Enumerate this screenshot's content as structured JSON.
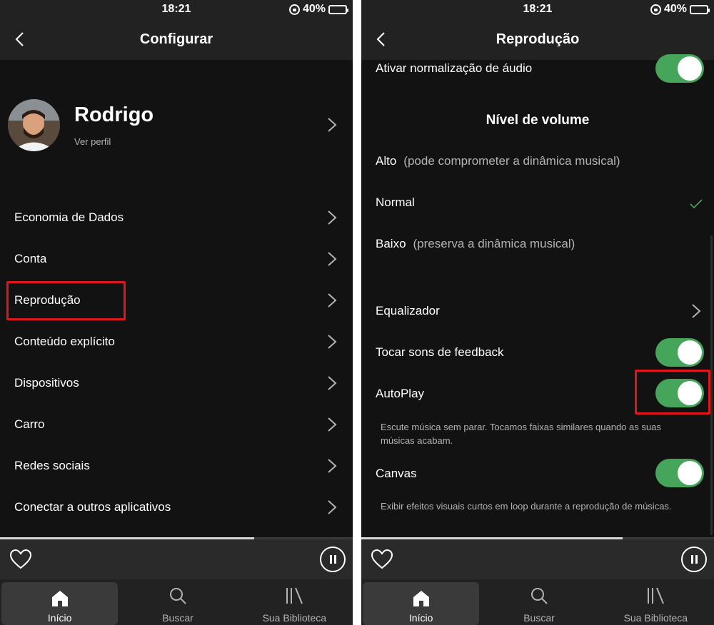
{
  "status": {
    "time": "18:21",
    "battery": "40%"
  },
  "left": {
    "title": "Configurar",
    "profile": {
      "name": "Rodrigo",
      "sub": "Ver perfil"
    },
    "menu": [
      {
        "label": "Economia de Dados"
      },
      {
        "label": "Conta"
      },
      {
        "label": "Reprodução"
      },
      {
        "label": "Conteúdo explícito"
      },
      {
        "label": "Dispositivos"
      },
      {
        "label": "Carro"
      },
      {
        "label": "Redes sociais"
      },
      {
        "label": "Conectar a outros aplicativos"
      }
    ]
  },
  "right": {
    "title": "Reprodução",
    "normalize": "Ativar normalização de áudio",
    "volume_title": "Nível de volume",
    "volume": [
      {
        "label": "Alto",
        "hint": "(pode comprometer a dinâmica musical)"
      },
      {
        "label": "Normal",
        "hint": "",
        "selected": true
      },
      {
        "label": "Baixo",
        "hint": "(preserva a dinâmica musical)"
      }
    ],
    "equalizer": "Equalizador",
    "feedback": "Tocar sons de feedback",
    "autoplay": "AutoPlay",
    "autoplay_desc": "Escute música sem parar. Tocamos faixas similares quando as suas músicas acabam.",
    "canvas": "Canvas",
    "canvas_desc": "Exibir efeitos visuais curtos em loop durante a reprodução de músicas.",
    "toggles": {
      "normalize": true,
      "feedback": true,
      "autoplay": true,
      "canvas": true
    }
  },
  "player": {
    "progress_left": 0.72,
    "progress_right": 0.74
  },
  "tabs": [
    {
      "label": "Início",
      "icon": "home-icon"
    },
    {
      "label": "Buscar",
      "icon": "search-icon"
    },
    {
      "label": "Sua Biblioteca",
      "icon": "library-icon"
    }
  ],
  "colors": {
    "accent": "#45a55a",
    "highlight": "#e0161d",
    "background": "#121212"
  }
}
